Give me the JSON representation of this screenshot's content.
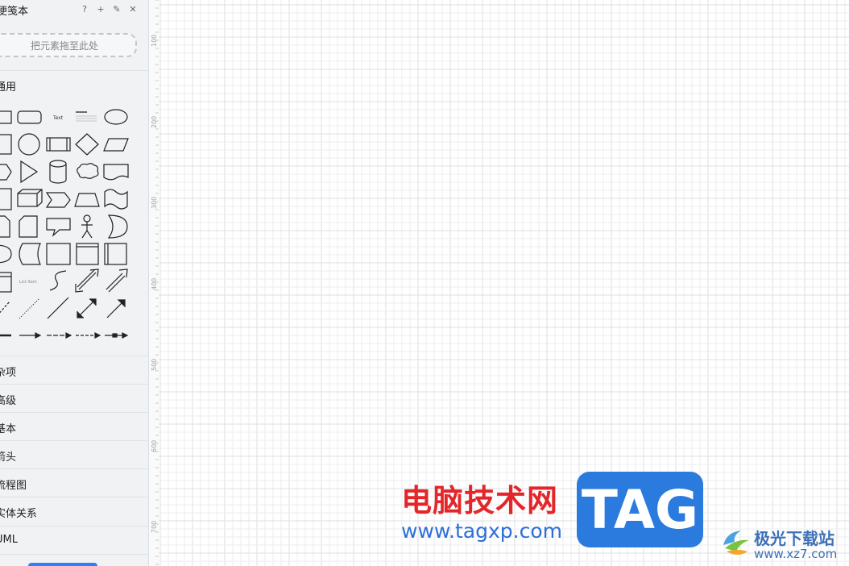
{
  "sidebar": {
    "title": "便笺本",
    "tools": {
      "help": "?",
      "add": "+",
      "edit": "✎",
      "close": "✕"
    },
    "dropzone": "把元素拖至此处",
    "sections": [
      "通用",
      "杂项",
      "高级",
      "基本",
      "箭头",
      "流程图",
      "实体关系",
      "UML"
    ]
  },
  "canvas": {
    "ruler_labels": [
      "100",
      "200",
      "300",
      "400",
      "500",
      "600",
      "700"
    ],
    "grid_minor_color": "#eceef0",
    "grid_major_color": "#dcdfe3"
  },
  "watermark": {
    "site_cn": "电脑技术网",
    "site_url": "www.tagxp.com",
    "tag": "TAG",
    "logo2_text": "极光下载站",
    "logo2_url": "www.xz7.com"
  }
}
